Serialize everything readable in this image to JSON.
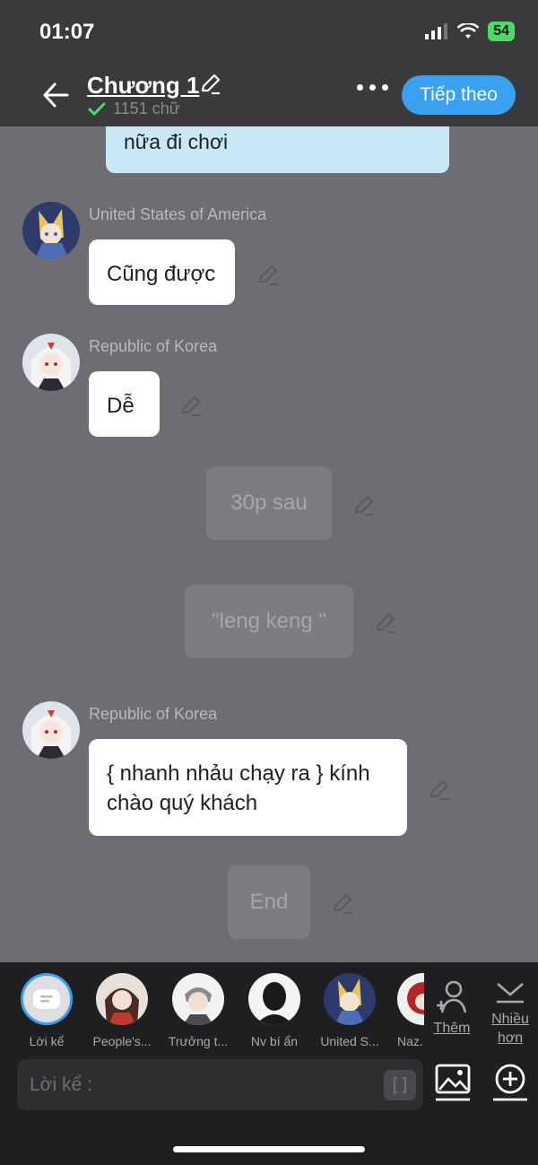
{
  "status": {
    "time": "01:07",
    "battery": "54"
  },
  "header": {
    "title": "Chương 1",
    "word_count": "1151 chữ",
    "next_label": "Tiếp theo"
  },
  "chat": {
    "top_bubble": "nữa đi chơi",
    "messages": [
      {
        "speaker": "United States of America",
        "text": "Cũng được"
      },
      {
        "speaker": "Republic of Korea",
        "text": "Dễ"
      },
      {
        "narration": "30p sau"
      },
      {
        "narration": "\"leng keng \""
      },
      {
        "speaker": "Republic of Korea",
        "text": "{ nhanh nhảu chạy ra } kính chào quý khách"
      },
      {
        "narration": "End"
      }
    ]
  },
  "characters": [
    {
      "name": "Lời kể"
    },
    {
      "name": "People's..."
    },
    {
      "name": "Trưởng t..."
    },
    {
      "name": "Nv bí ẩn"
    },
    {
      "name": "United S..."
    },
    {
      "name": "Naz..."
    }
  ],
  "tray": {
    "add_label": "Thêm",
    "more_label": "Nhiều hơn"
  },
  "input": {
    "placeholder": "Lời kể :"
  },
  "colors": {
    "accent": "#3aa0f0",
    "top_bubble": "#c8e7f7",
    "check": "#4cd964"
  }
}
